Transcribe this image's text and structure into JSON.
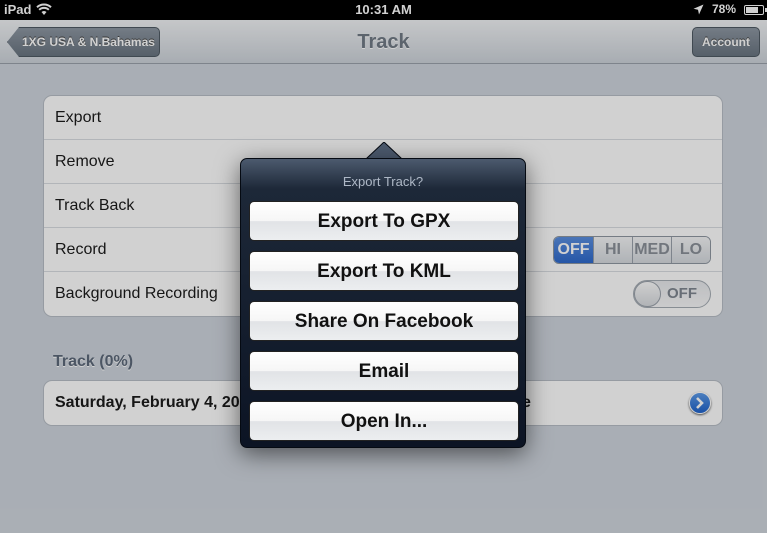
{
  "status": {
    "device": "iPad",
    "time": "10:31 AM",
    "battery": "78%",
    "battery_level": 0.78
  },
  "nav": {
    "back_label": "1XG USA & N.Bahamas",
    "title": "Track",
    "account_label": "Account"
  },
  "settings": {
    "rows": [
      {
        "label": "Export"
      },
      {
        "label": "Remove"
      },
      {
        "label": "Track Back"
      },
      {
        "label": "Record"
      },
      {
        "label": "Background Recording"
      }
    ],
    "record_options": [
      "OFF",
      "HI",
      "MED",
      "LO"
    ],
    "record_selected": "OFF",
    "background_toggle": "OFF"
  },
  "track_section": {
    "header": "Track (0%)",
    "item_left": "Saturday, February 4, 20",
    "item_right": "e"
  },
  "popover": {
    "title": "Export Track?",
    "buttons": [
      "Export To GPX",
      "Export To KML",
      "Share On Facebook",
      "Email",
      "Open In..."
    ]
  },
  "colors": {
    "accent": "#2f6acc",
    "popover_bg": "#0c1424"
  }
}
